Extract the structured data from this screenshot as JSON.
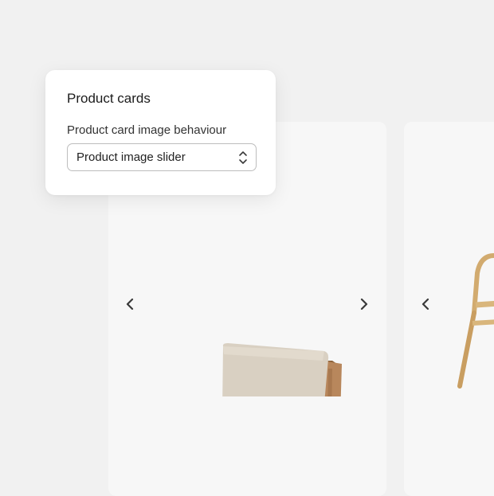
{
  "panel": {
    "title": "Product cards",
    "field_label": "Product card image behaviour",
    "selected_value": "Product image slider"
  },
  "icons": {
    "prev": "chevron-left-icon",
    "next": "chevron-right-icon",
    "select": "chevron-up-down-icon"
  },
  "colors": {
    "background": "#f1f1f1",
    "card": "#f7f7f7",
    "panel": "#ffffff",
    "arrow": "#3a3a3a"
  }
}
